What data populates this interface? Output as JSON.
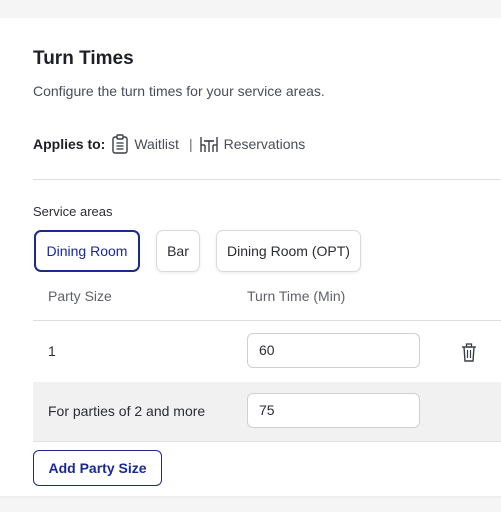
{
  "header": {
    "title": "Turn Times",
    "description": "Configure the turn times for your service areas."
  },
  "applies_to": {
    "label": "Applies to:",
    "items": [
      {
        "icon": "clipboard-list-icon",
        "label": "Waitlist"
      },
      {
        "icon": "table-chairs-icon",
        "label": "Reservations"
      }
    ],
    "separator": "|"
  },
  "service_areas": {
    "label": "Service areas",
    "chips": [
      {
        "label": "Dining Room",
        "active": true
      },
      {
        "label": "Bar",
        "active": false
      },
      {
        "label": "Dining Room (OPT)",
        "active": false
      }
    ]
  },
  "table": {
    "columns": [
      "Party Size",
      "Turn Time (Min)"
    ],
    "rows": [
      {
        "party_size": "1",
        "turn_time": "60",
        "delete_icon": "trash-icon"
      },
      {
        "party_size": "For parties of 2 and more",
        "turn_time": "75"
      }
    ]
  },
  "actions": {
    "add_party_size": "Add Party Size"
  },
  "colors": {
    "accent": "#1a2a8f",
    "row_highlight": "#f1f1f2"
  }
}
